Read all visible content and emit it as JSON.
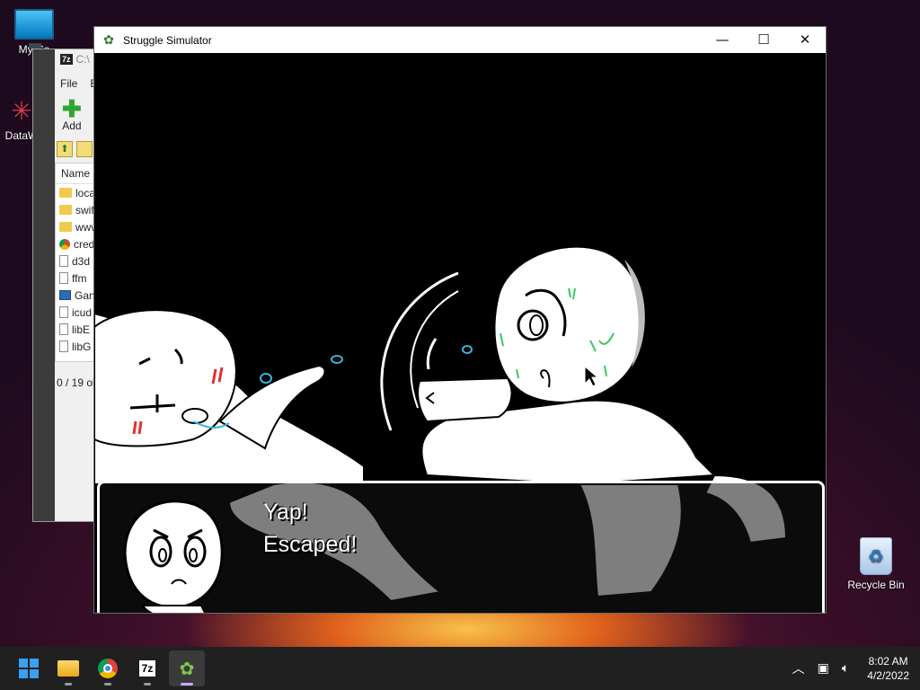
{
  "desktop": {
    "icons": [
      {
        "label": "My Co"
      },
      {
        "label": "DataW"
      },
      {
        "label": "Recycle Bin"
      }
    ]
  },
  "sevenzip": {
    "title": "C:\\",
    "logo": "7z",
    "menu": [
      "File",
      "E"
    ],
    "add_label": "Add",
    "list_header": "Name",
    "rows": [
      {
        "name": "loca",
        "icon": "folder-icon"
      },
      {
        "name": "swif",
        "icon": "folder-icon"
      },
      {
        "name": "www",
        "icon": "folder-icon"
      },
      {
        "name": "cred",
        "icon": "chrome-icon"
      },
      {
        "name": "d3d",
        "icon": "file-icon"
      },
      {
        "name": "ffm",
        "icon": "file-icon"
      },
      {
        "name": "Gan",
        "icon": "app-icon"
      },
      {
        "name": "icud",
        "icon": "file-icon"
      },
      {
        "name": "libE",
        "icon": "file-icon"
      },
      {
        "name": "libG",
        "icon": "file-icon"
      }
    ],
    "status": "0 / 19 ob"
  },
  "window": {
    "title": "Struggle Simulator",
    "controls": {
      "minimize": "—",
      "maximize": "☐",
      "close": "✕"
    }
  },
  "dialogue": {
    "text": "Yap!\nEscaped!"
  },
  "taskbar": {
    "apps": [
      "start",
      "file-explorer",
      "chrome",
      "7-zip",
      "struggle-simulator"
    ],
    "sevenzip_label": "7z",
    "time": "8:02 AM",
    "date": "4/2/2022"
  },
  "colors": {
    "window_bg": "#000000",
    "character_fill": "#ffffff",
    "sweat": "#3cc85a",
    "tear": "#3ab4d8",
    "blush": "#e03030",
    "taskbar": "#202020"
  }
}
